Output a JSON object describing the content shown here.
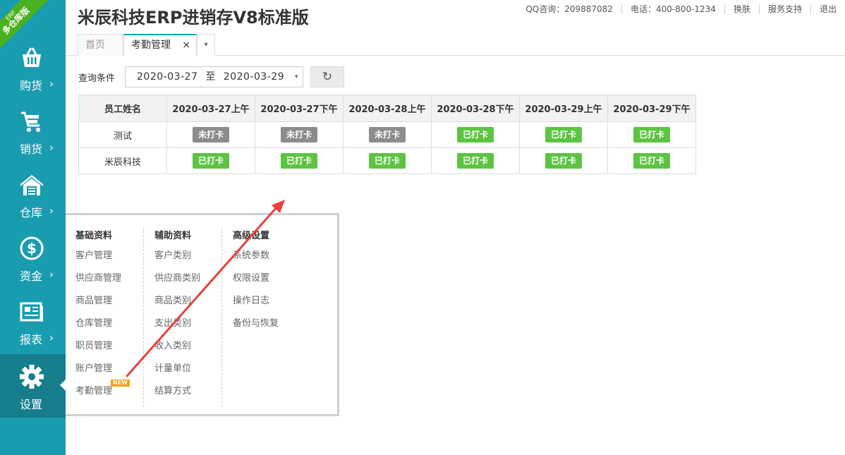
{
  "sidebar": {
    "ribbon": {
      "small": "ERP",
      "main": "多仓库版"
    },
    "items": [
      {
        "label": "购货",
        "icon": "basket-icon",
        "active": false
      },
      {
        "label": "销货",
        "icon": "cart-icon",
        "active": false
      },
      {
        "label": "仓库",
        "icon": "warehouse-icon",
        "active": false
      },
      {
        "label": "资金",
        "icon": "dollar-icon",
        "active": false
      },
      {
        "label": "报表",
        "icon": "report-icon",
        "active": false
      },
      {
        "label": "设置",
        "icon": "gear-icon",
        "active": true
      }
    ],
    "arrow": "›",
    "colors": {
      "background": "#1a9cb0",
      "active": "#167d8d",
      "ribbon": "#4caf1f"
    }
  },
  "header": {
    "title": "米辰科技ERP进销存V8标准版",
    "links": [
      "QQ咨询：209887082",
      "电话：400-800-1234",
      "换肤",
      "服务支持",
      "退出"
    ]
  },
  "tabs": {
    "home": "首页",
    "current": "考勤管理",
    "close": "×",
    "more": "▾"
  },
  "query": {
    "label": "查询条件",
    "start": "2020-03-27",
    "separator": "至",
    "end": "2020-03-29",
    "dropdown": "▾",
    "refresh": "↻"
  },
  "table": {
    "headers": [
      "员工姓名",
      "2020-03-27上午",
      "2020-03-27下午",
      "2020-03-28上午",
      "2020-03-28下午",
      "2020-03-29上午",
      "2020-03-29下午"
    ],
    "rows": [
      {
        "name": "测试",
        "cells": [
          "未打卡",
          "未打卡",
          "未打卡",
          "已打卡",
          "已打卡",
          "已打卡"
        ]
      },
      {
        "name": "米辰科技",
        "cells": [
          "已打卡",
          "已打卡",
          "已打卡",
          "已打卡",
          "已打卡",
          "已打卡"
        ]
      }
    ],
    "colors": {
      "unpunched": "#8c8c8c",
      "punched": "#5cc441"
    }
  },
  "menu": {
    "columns": [
      {
        "title": "基础资料",
        "items": [
          "客户管理",
          "供应商管理",
          "商品管理",
          "仓库管理",
          "职员管理",
          "账户管理",
          "考勤管理"
        ]
      },
      {
        "title": "辅助资料",
        "items": [
          "客户类别",
          "供应商类别",
          "商品类别",
          "支出类别",
          "收入类别",
          "计量单位",
          "结算方式"
        ]
      },
      {
        "title": "高级设置",
        "items": [
          "系统参数",
          "权限设置",
          "操作日志",
          "备份与恢复"
        ]
      }
    ],
    "new_tag": "NEW"
  },
  "annotation": {
    "color": "#e8413a"
  }
}
